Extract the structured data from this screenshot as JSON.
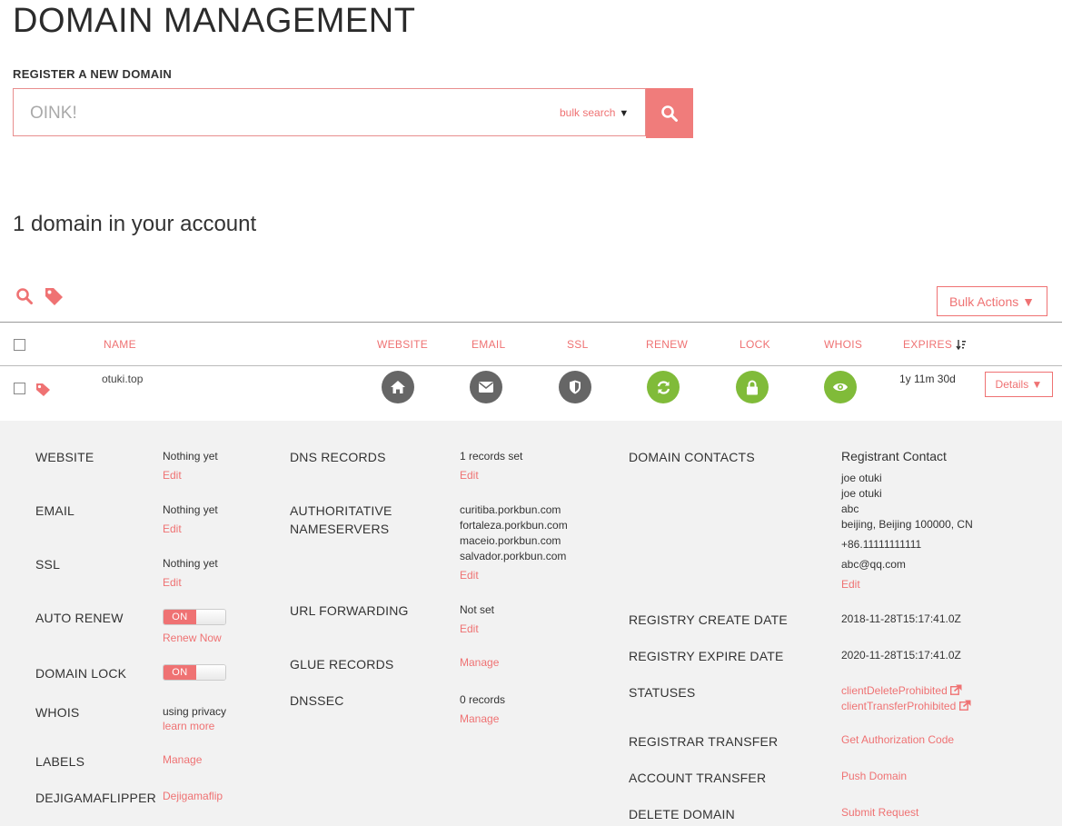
{
  "page_title": "DOMAIN MANAGEMENT",
  "register": {
    "label": "REGISTER A NEW DOMAIN",
    "placeholder": "OINK!",
    "bulk_search": "bulk search"
  },
  "account_summary": "1 domain in your account",
  "bulk_actions": "Bulk Actions ▼",
  "columns": {
    "name": "NAME",
    "website": "WEBSITE",
    "email": "EMAIL",
    "ssl": "SSL",
    "renew": "RENEW",
    "lock": "LOCK",
    "whois": "WHOIS",
    "expires": "EXPIRES"
  },
  "domain_row": {
    "name": "otuki.top",
    "expires": "1y 11m 30d",
    "details": "Details ▼"
  },
  "details": {
    "website": {
      "label": "WEBSITE",
      "value": "Nothing yet",
      "link": "Edit"
    },
    "email": {
      "label": "EMAIL",
      "value": "Nothing yet",
      "link": "Edit"
    },
    "ssl": {
      "label": "SSL",
      "value": "Nothing yet",
      "link": "Edit"
    },
    "auto_renew": {
      "label": "AUTO RENEW",
      "toggle": "ON",
      "link": "Renew Now"
    },
    "domain_lock": {
      "label": "DOMAIN LOCK",
      "toggle": "ON"
    },
    "whois": {
      "label": "WHOIS",
      "value": "using privacy",
      "link": "learn more"
    },
    "labels": {
      "label": "LABELS",
      "link": "Manage"
    },
    "dejigama": {
      "label": "DEJIGAMAFLIPPER",
      "link": "Dejigamaflip"
    },
    "dns_records": {
      "label": "DNS RECORDS",
      "value": "1 records set",
      "link": "Edit"
    },
    "nameservers": {
      "label_line1": "AUTHORITATIVE",
      "label_line2": "NAMESERVERS",
      "values": [
        "curitiba.porkbun.com",
        "fortaleza.porkbun.com",
        "maceio.porkbun.com",
        "salvador.porkbun.com"
      ],
      "link": "Edit"
    },
    "url_forwarding": {
      "label": "URL FORWARDING",
      "value": "Not set",
      "link": "Edit"
    },
    "glue_records": {
      "label": "GLUE RECORDS",
      "link": "Manage"
    },
    "dnssec": {
      "label": "DNSSEC",
      "value": "0 records",
      "link": "Manage"
    },
    "domain_contacts": {
      "label": "DOMAIN CONTACTS",
      "heading": "Registrant Contact",
      "lines": [
        "joe otuki",
        "joe otuki",
        "abc",
        "beijing, Beijing 100000, CN"
      ],
      "phone": "+86.11111111111",
      "email": "abc@qq.com",
      "link": "Edit"
    },
    "registry_create": {
      "label": "REGISTRY CREATE DATE",
      "value": "2018-11-28T15:17:41.0Z"
    },
    "registry_expire": {
      "label": "REGISTRY EXPIRE DATE",
      "value": "2020-11-28T15:17:41.0Z"
    },
    "statuses": {
      "label": "STATUSES",
      "values": [
        "clientDeleteProhibited",
        "clientTransferProhibited"
      ]
    },
    "registrar_transfer": {
      "label": "REGISTRAR TRANSFER",
      "link": "Get Authorization Code"
    },
    "account_transfer": {
      "label": "ACCOUNT TRANSFER",
      "link": "Push Domain"
    },
    "delete_domain": {
      "label": "DELETE DOMAIN",
      "link": "Submit Request"
    }
  },
  "colors": {
    "accent": "#ef7273",
    "status_green": "#80bb39",
    "icon_grey": "#666666",
    "panel_bg": "#f2f2f2"
  },
  "icons": [
    "search-icon",
    "tag-icon",
    "home-icon",
    "envelope-icon",
    "shield-icon",
    "refresh-icon",
    "lock-icon",
    "eye-icon",
    "sort-icon",
    "external-link-icon"
  ]
}
